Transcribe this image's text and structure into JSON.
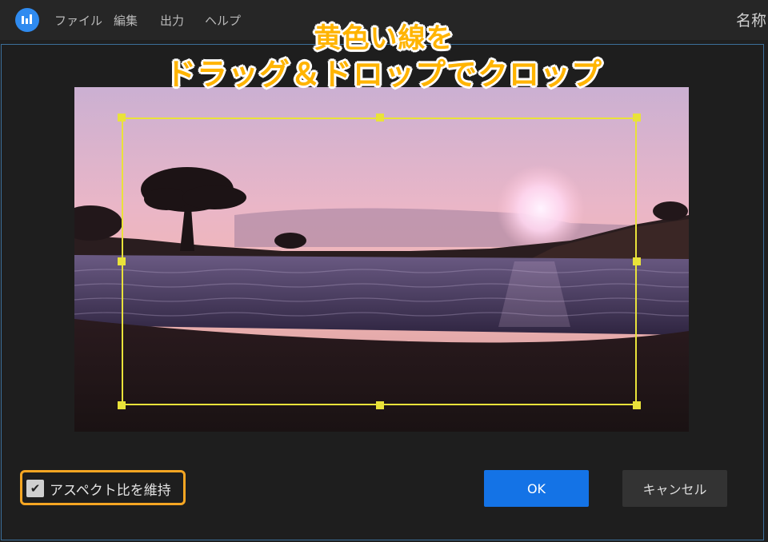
{
  "menubar": {
    "items": [
      "ファイル",
      "編集",
      "出力",
      "ヘルプ"
    ],
    "title_partial": "名称"
  },
  "annotation": {
    "line1": "黄色い線を",
    "line2": "ドラッグ＆ドロップでクロップ",
    "color": "#ffb400"
  },
  "crop": {
    "frame_color": "#e9e23a",
    "aspect_checkbox_checked": true,
    "aspect_label": "アスペクト比を維持"
  },
  "buttons": {
    "ok": "OK",
    "cancel": "キャンセル"
  },
  "colors": {
    "ok_button": "#1473e6",
    "highlight_box": "#f5a623"
  }
}
